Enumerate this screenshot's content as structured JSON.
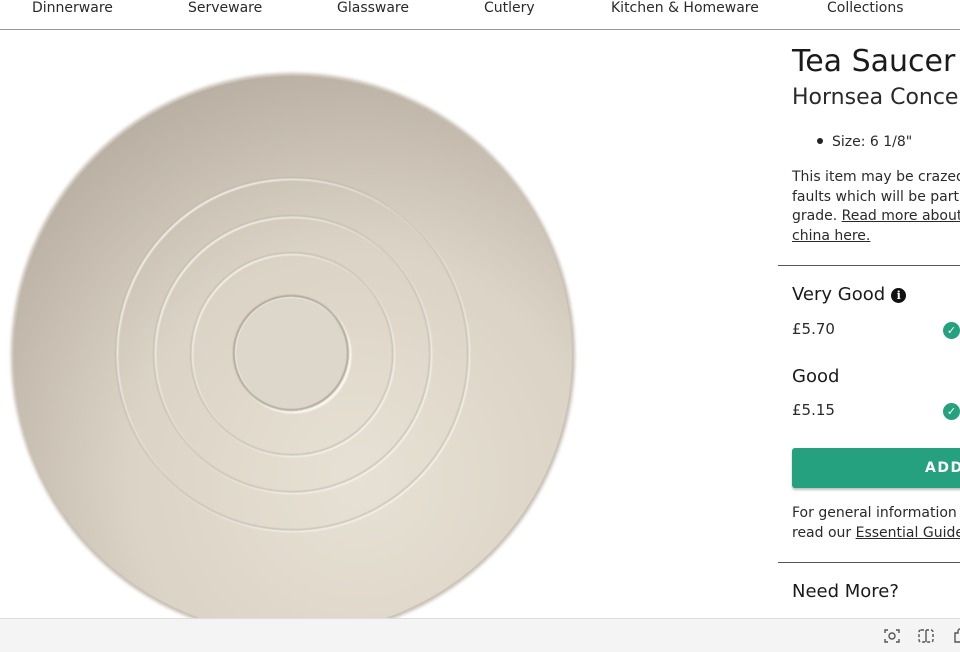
{
  "nav": {
    "items": [
      {
        "label": "Dinnerware"
      },
      {
        "label": "Serveware"
      },
      {
        "label": "Glassware"
      },
      {
        "label": "Cutlery"
      },
      {
        "label": "Kitchen & Homeware"
      },
      {
        "label": "Collections"
      }
    ]
  },
  "product": {
    "title": "Tea Saucer",
    "subtitle": "Hornsea Concep",
    "spec": "Size: 6 1/8\"",
    "note": {
      "line1": "This item may be crazed",
      "line2": "faults which will be partic",
      "line3_text": "grade. ",
      "line3_link": "Read more about",
      "line4_link": "china here."
    }
  },
  "grades": [
    {
      "name": "Very Good",
      "price": "£5.70",
      "has_info": true
    },
    {
      "name": "Good",
      "price": "£5.15",
      "has_info": false
    }
  ],
  "add_button": "ADD",
  "guide": {
    "line1": "For general information o",
    "line2_text": "read our ",
    "line2_link": "Essential Guide",
    "line2_suffix": "."
  },
  "need_more": "Need More?",
  "icons": {
    "info": "info-icon",
    "check": "check-icon",
    "bottom_bar": [
      "screenshot-icon",
      "split-view-icon",
      "extension-icon"
    ]
  },
  "colors": {
    "accent": "#26a17f",
    "plate": "#d9d1c3"
  }
}
